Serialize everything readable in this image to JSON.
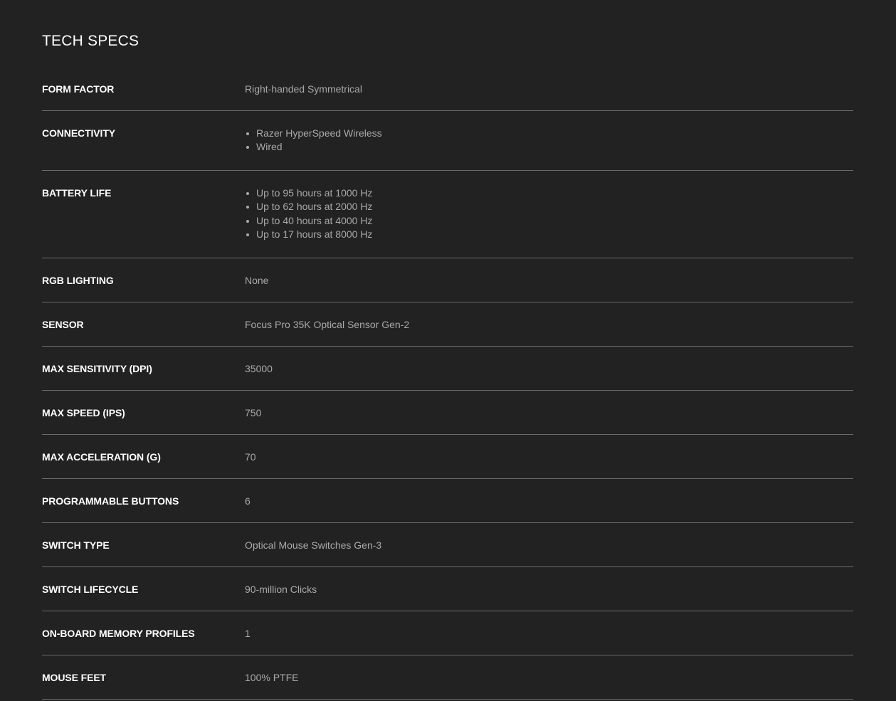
{
  "title": "TECH SPECS",
  "specs": [
    {
      "label": "FORM FACTOR",
      "value": "Right-handed Symmetrical"
    },
    {
      "label": "CONNECTIVITY",
      "items": [
        "Razer HyperSpeed Wireless",
        "Wired"
      ]
    },
    {
      "label": "BATTERY LIFE",
      "items": [
        "Up to 95 hours at 1000 Hz",
        "Up to 62 hours at 2000 Hz",
        "Up to 40 hours at 4000 Hz",
        "Up to 17 hours at 8000 Hz"
      ]
    },
    {
      "label": "RGB LIGHTING",
      "value": "None"
    },
    {
      "label": "SENSOR",
      "value": "Focus Pro 35K Optical Sensor Gen-2"
    },
    {
      "label": "MAX SENSITIVITY (DPI)",
      "value": "35000"
    },
    {
      "label": "MAX SPEED (IPS)",
      "value": "750"
    },
    {
      "label": "MAX ACCELERATION (G)",
      "value": "70"
    },
    {
      "label": "PROGRAMMABLE BUTTONS",
      "value": "6"
    },
    {
      "label": "SWITCH TYPE",
      "value": "Optical Mouse Switches Gen-3"
    },
    {
      "label": "SWITCH LIFECYCLE",
      "value": "90-million Clicks"
    },
    {
      "label": "ON-BOARD MEMORY PROFILES",
      "value": "1"
    },
    {
      "label": "MOUSE FEET",
      "value": "100% PTFE"
    }
  ]
}
